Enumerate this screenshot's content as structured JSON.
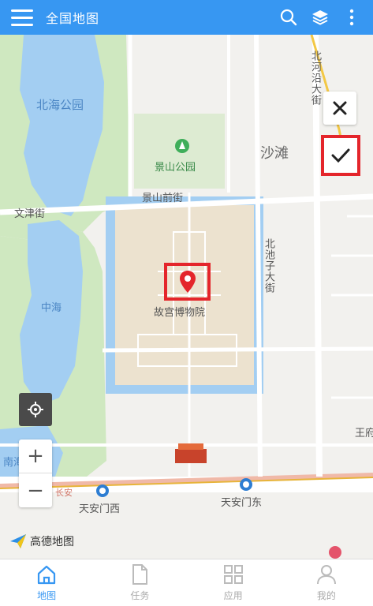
{
  "header": {
    "title": "全国地图",
    "actions": [
      "search-icon",
      "layers-icon",
      "more-icon"
    ]
  },
  "map": {
    "labels": {
      "beihai": "北海公园",
      "jingshan": "景山公园",
      "shatan": "沙滩",
      "jingshan_front": "景山前街",
      "wenjin": "文津街",
      "beichizi": "北池子大街",
      "beiheyan": "北河沿大街",
      "gugong": "故宫博物院",
      "zhonghai": "中海",
      "nanhai": "南海",
      "tiananmen_west": "天安门西",
      "tiananmen_east": "天安门东",
      "wangfu": "王府",
      "changan": "长安"
    },
    "logo": "高德地图"
  },
  "controls": {
    "cancel": "close-icon",
    "confirm": "check-icon",
    "zoom_in": "+",
    "zoom_out": "−"
  },
  "colors": {
    "accent": "#3797f2",
    "highlight": "#e4252b",
    "water": "#a3cef2",
    "park": "#cfe8c0"
  },
  "tabs": [
    {
      "label": "地图",
      "icon": "home-icon",
      "active": true
    },
    {
      "label": "任务",
      "icon": "document-icon",
      "active": false
    },
    {
      "label": "应用",
      "icon": "grid-icon",
      "active": false
    },
    {
      "label": "我的",
      "icon": "user-icon",
      "active": false
    }
  ]
}
